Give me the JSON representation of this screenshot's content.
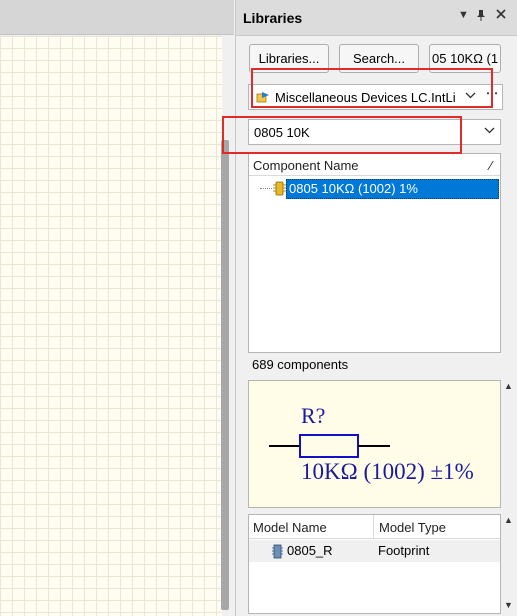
{
  "panel": {
    "title": "Libraries",
    "header_icons": [
      "dropdown-icon",
      "pin-icon",
      "close-icon"
    ]
  },
  "toolbar": {
    "libraries_label": "Libraries...",
    "search_label": "Search...",
    "place_label": "05 10KΩ (1"
  },
  "library_select": {
    "value": "Miscellaneous Devices LC.IntLi",
    "more_label": "⋯"
  },
  "filter": {
    "value": "0805 10K"
  },
  "component_list": {
    "column_header": "Component Name",
    "items": [
      {
        "name": "0805 10KΩ (1002) 1%",
        "selected": true
      }
    ]
  },
  "count_text": "689 components",
  "preview": {
    "designator": "R?",
    "value": "10KΩ (1002) ±1%"
  },
  "models": {
    "columns": [
      "Model Name",
      "Model Type"
    ],
    "rows": [
      {
        "name": "0805_R",
        "type": "Footprint"
      }
    ]
  },
  "colors": {
    "selection": "#0078d7",
    "highlight_box": "#e02b2b",
    "preview_ink": "#1a1aa0",
    "preview_bg": "#fffde7"
  }
}
